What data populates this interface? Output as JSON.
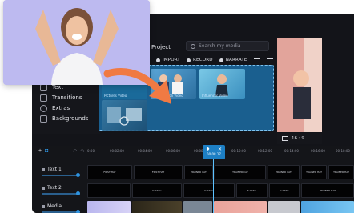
{
  "sidebar": {
    "items": [
      {
        "label": "Text",
        "icon": "text-icon"
      },
      {
        "label": "Transitions",
        "icon": "transitions-icon"
      },
      {
        "label": "Extras",
        "icon": "extras-icon"
      },
      {
        "label": "Backgrounds",
        "icon": "backgrounds-icon"
      }
    ]
  },
  "media": {
    "project_label": "Project",
    "search_placeholder": "Search my media",
    "actions": {
      "import": "IMPORT",
      "record": "RECORD",
      "narrate": "NARRATE"
    },
    "thumbnails": [
      {
        "caption": "Pictures Video"
      },
      {
        "caption": "Presentation Video"
      },
      {
        "caption": "Influencer Video"
      }
    ]
  },
  "preview": {
    "ratio": "16 : 9"
  },
  "timeline": {
    "playhead_time": "00:08.17",
    "ruler_labels": [
      "0:00",
      "00:02:00",
      "00:04:00",
      "00:06:00",
      "00:08:00",
      "00:10:00",
      "00:12:00",
      "00:14:00",
      "00:16:00",
      "00:18:00"
    ],
    "tracks": [
      {
        "name": "Text 1",
        "clips": [
          "FIRST HAT",
          "FIRST HAT",
          "TRAINER CAT",
          "TRAINER CAT",
          "TRAINER CAT",
          "TRAINER HAT",
          "TRAINER HAT"
        ]
      },
      {
        "name": "Text 2",
        "clips": [
          "",
          "Subtitle",
          "Subtitle",
          "Subtitle",
          "Subtitle",
          "TRAINER HAT"
        ]
      },
      {
        "name": "Media",
        "clips": [
          "",
          "",
          "",
          "",
          "",
          "",
          ""
        ]
      }
    ]
  },
  "colors": {
    "accent": "#1d7fc4",
    "panel": "#131419",
    "drop": "#1a5f8f",
    "arrow": "#f07a43"
  }
}
